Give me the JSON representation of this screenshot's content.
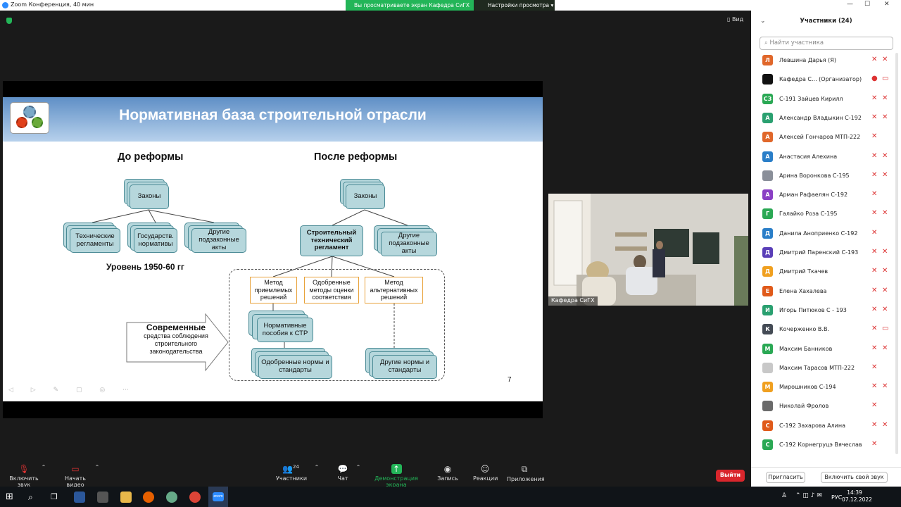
{
  "window": {
    "title": "Zoom Конференция, 40 мин",
    "controls": [
      "—",
      "☐",
      "✕"
    ]
  },
  "share_banner": {
    "text": "Вы просматриваете экран Кафедра СиГХ",
    "view_options": "Настройки просмотра ▾"
  },
  "view_button": "▯ Вид",
  "slide": {
    "title": "Нормативная база строительной отрасли",
    "before_heading": "До реформы",
    "after_heading": "После реформы",
    "before": {
      "laws": "Законы",
      "tech_reg": "Технические регламенты",
      "state_norms": "Государств. нормативы",
      "other_acts": "Другие подзаконные акты",
      "level": "Уровень 1950-60 гг"
    },
    "after": {
      "laws": "Законы",
      "str": "Строительный технический регламент",
      "other_acts": "Другие подзаконные акты",
      "method_acceptable": "Метод приемлемых решений",
      "approved_methods": "Одобренные методы оценки соответствия",
      "method_alt": "Метод альтернативных решений",
      "manuals": "Нормативные пособия к СТР",
      "approved_norms": "Одобренные нормы и стандарты",
      "other_norms": "Другие нормы и стандарты"
    },
    "arrow_title": "Современные",
    "arrow_text": "средства соблюдения строительного законодательства",
    "page_number": "7",
    "tools": "◁ ▷ ✎ ▢ ◎ ⋯"
  },
  "camera": {
    "name": "Кафедра СиГХ"
  },
  "participants": {
    "header": "Участники (24)",
    "search_placeholder": "Найти участника",
    "list": [
      {
        "initial": "Л",
        "name": "Левшина Дарья (Я)",
        "color": "#e0672a",
        "mic": "✕",
        "cam": "✕"
      },
      {
        "initial": "",
        "name": "Кафедра С...  (Организатор)",
        "color": "#111111",
        "mic": "●",
        "cam": "▭"
      },
      {
        "initial": "СЗ",
        "name": "С-191 Зайцев Кирилл",
        "color": "#2aa854",
        "mic": "✕",
        "cam": "✕"
      },
      {
        "initial": "А",
        "name": "Александр Владыкин С-192",
        "color": "#2aa070",
        "mic": "✕",
        "cam": "✕"
      },
      {
        "initial": "А",
        "name": "Алексей Гончаров МТП-222",
        "color": "#e0672a",
        "mic": "✕",
        "cam": ""
      },
      {
        "initial": "А",
        "name": "Анастасия Алехина",
        "color": "#2a7ec8",
        "mic": "✕",
        "cam": "✕"
      },
      {
        "initial": "",
        "name": "Арина Воронкова С-195",
        "color": "#8a8f99",
        "mic": "✕",
        "cam": "✕"
      },
      {
        "initial": "А",
        "name": "Арман Рафаелян С-192",
        "color": "#8a3fc4",
        "mic": "✕",
        "cam": ""
      },
      {
        "initial": "Г",
        "name": "Галайко Роза С-195",
        "color": "#2aa854",
        "mic": "✕",
        "cam": "✕"
      },
      {
        "initial": "Д",
        "name": "Данила Аноприенко С-192",
        "color": "#2a7ec8",
        "mic": "✕",
        "cam": ""
      },
      {
        "initial": "Д",
        "name": "Дмитрий Паренский С-193",
        "color": "#5a3fb8",
        "mic": "✕",
        "cam": "✕"
      },
      {
        "initial": "Д",
        "name": "Дмитрий Ткачев",
        "color": "#f0a020",
        "mic": "✕",
        "cam": "✕"
      },
      {
        "initial": "Е",
        "name": "Елена Хахалева",
        "color": "#e05a1a",
        "mic": "✕",
        "cam": "✕"
      },
      {
        "initial": "И",
        "name": "Игорь Питюков С - 193",
        "color": "#2aa070",
        "mic": "✕",
        "cam": "✕"
      },
      {
        "initial": "К",
        "name": "Кочерженко В.В.",
        "color": "#444b55",
        "mic": "✕",
        "cam": "▭"
      },
      {
        "initial": "М",
        "name": "Максим Банников",
        "color": "#2aa854",
        "mic": "✕",
        "cam": "✕"
      },
      {
        "initial": "",
        "name": "Максим Тарасов МТП-222",
        "color": "#c8c8c8",
        "mic": "✕",
        "cam": ""
      },
      {
        "initial": "М",
        "name": "Мирошников С-194",
        "color": "#f0a020",
        "mic": "✕",
        "cam": "✕"
      },
      {
        "initial": "",
        "name": "Николай Фролов",
        "color": "#6a6a6a",
        "mic": "✕",
        "cam": ""
      },
      {
        "initial": "С",
        "name": "С-192 Захарова Алина",
        "color": "#e05a1a",
        "mic": "✕",
        "cam": "✕"
      },
      {
        "initial": "С",
        "name": "С-192 Корнегруцэ Вячеслав",
        "color": "#2aa854",
        "mic": "✕",
        "cam": ""
      }
    ],
    "invite": "Пригласить",
    "unmute_me": "Включить свой звук"
  },
  "toolbar": {
    "audio": "Включить звук",
    "video": "Начать видео",
    "participants": "Участники",
    "participants_count": "24",
    "chat": "Чат",
    "share": "Демонстрация экрана",
    "record": "Запись",
    "reactions": "Реакции",
    "apps": "Приложения",
    "leave": "Выйти"
  },
  "taskbar": {
    "lang": "РУС",
    "time": "14:39",
    "date": "07.12.2022",
    "tray": "⌃ ◫ ♪ ✉"
  }
}
